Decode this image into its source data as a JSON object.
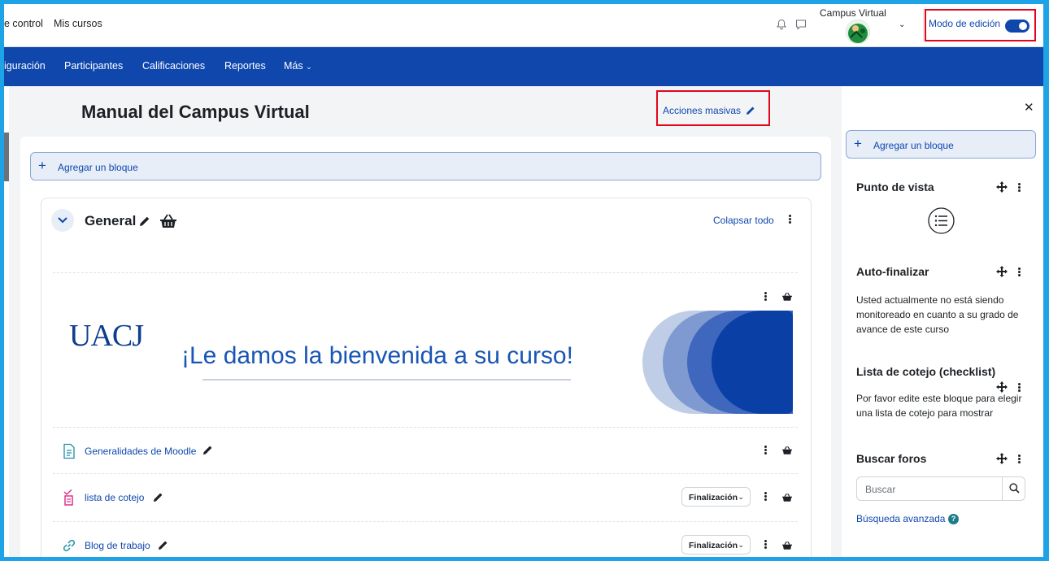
{
  "topbar": {
    "nav_links": [
      "e control",
      "Mis cursos"
    ],
    "user_name": "Campus Virtual",
    "edit_mode_label": "Modo de edición",
    "edit_mode_on": true
  },
  "course_nav": {
    "items": [
      "iguración",
      "Participantes",
      "Calificaciones",
      "Reportes",
      "Más"
    ]
  },
  "page": {
    "title": "Manual del Campus Virtual",
    "bulk_actions_label": "Acciones masivas",
    "add_block_label": "Agregar un bloque"
  },
  "section": {
    "title": "General",
    "collapse_all_label": "Colapsar todo",
    "banner": {
      "logo_text": "UACJ",
      "welcome_text": "¡Le damos la bienvenida a su curso!"
    },
    "activities": [
      {
        "name": "Generalidades de Moodle",
        "icon": "page-icon",
        "completion": ""
      },
      {
        "name": "lista de cotejo",
        "icon": "checklist-icon",
        "completion": "Finalización"
      },
      {
        "name": "Blog de trabajo",
        "icon": "link-icon",
        "completion": "Finalización"
      }
    ]
  },
  "drawer": {
    "add_block_label": "Agregar un bloque",
    "blocks": [
      {
        "title": "Punto de vista",
        "text": ""
      },
      {
        "title": "Auto-finalizar",
        "text": "Usted actualmente no está siendo monitoreado en cuanto a su grado de avance de este curso"
      },
      {
        "title": "Lista de cotejo (checklist)",
        "text": "Por favor edite este bloque para elegir una lista de cotejo para mostrar"
      },
      {
        "title": "Buscar foros",
        "text": ""
      }
    ],
    "search_placeholder": "Buscar",
    "advanced_search_label": "Búsqueda avanzada"
  },
  "colors": {
    "brand_blue": "#0f47ad",
    "highlight_red": "#e3051b",
    "frame_cyan": "#1ea3e6"
  }
}
